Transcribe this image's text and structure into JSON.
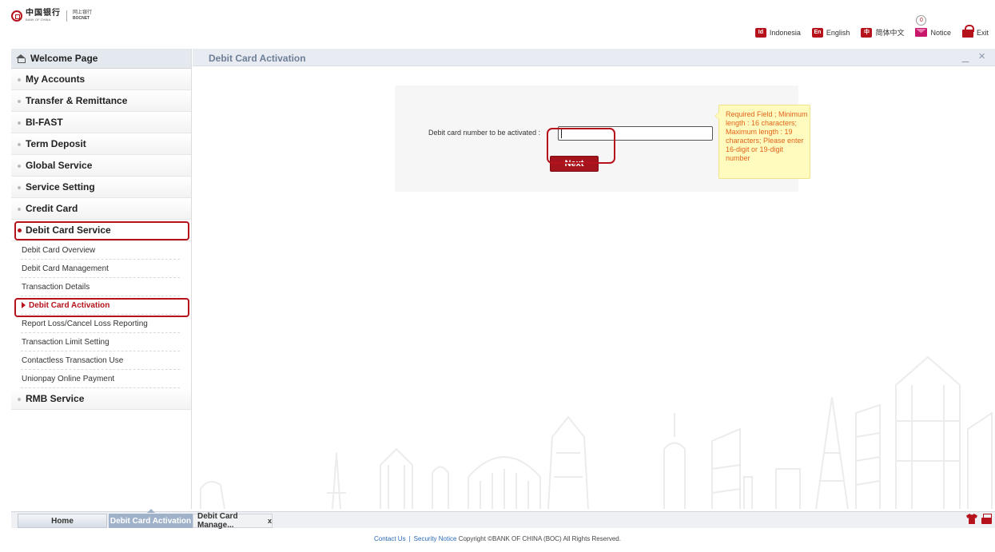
{
  "brand": {
    "bank_cn": "中国银行",
    "bank_en": "BANK OF CHINA",
    "net_cn": "网上银行",
    "net_en": "BOCNET"
  },
  "header": {
    "links": [
      {
        "badge": "Id",
        "label": "Indonesia"
      },
      {
        "badge": "En",
        "label": "English"
      },
      {
        "badge": "中",
        "label": "简体中文"
      }
    ],
    "notice_label": "Notice",
    "notice_count": "0",
    "exit_label": "Exit"
  },
  "sidebar": {
    "welcome": "Welcome Page",
    "items": [
      "My Accounts",
      "Transfer & Remittance",
      "BI-FAST",
      "Term Deposit",
      "Global Service",
      "Service Setting",
      "Credit Card",
      "Debit Card Service"
    ],
    "sub_items": [
      "Debit Card Overview",
      "Debit Card Management",
      "Transaction Details",
      "Debit Card Activation",
      "Report Loss/Cancel Loss Reporting",
      "Transaction Limit Setting",
      "Contactless Transaction Use",
      "Unionpay Online Payment"
    ],
    "last_item": "RMB Service"
  },
  "main": {
    "title": "Debit Card Activation",
    "minimize": "_",
    "close": "×",
    "field_label": "Debit card number to be activated :",
    "field_value": "",
    "next_label": "Next",
    "tooltip": "Required Field ; Minimum length : 16 characters; Maximum length : 19 characters; Please enter 16-digit or 19-digit number"
  },
  "tabs": {
    "home": "Home",
    "active": "Debit Card Activation",
    "manage": "Debit Card Manage...",
    "manage_close": "x"
  },
  "footer": {
    "contact": "Contact Us",
    "sep": "|",
    "security": "Security Notice",
    "copyright": "Copyright ©BANK OF CHINA (BOC) All Rights Reserved."
  },
  "colors": {
    "brand_red": "#b5121b",
    "tooltip_bg": "#fffbbf",
    "tooltip_text": "#e2641a",
    "active_tab": "#9fb2c9"
  }
}
